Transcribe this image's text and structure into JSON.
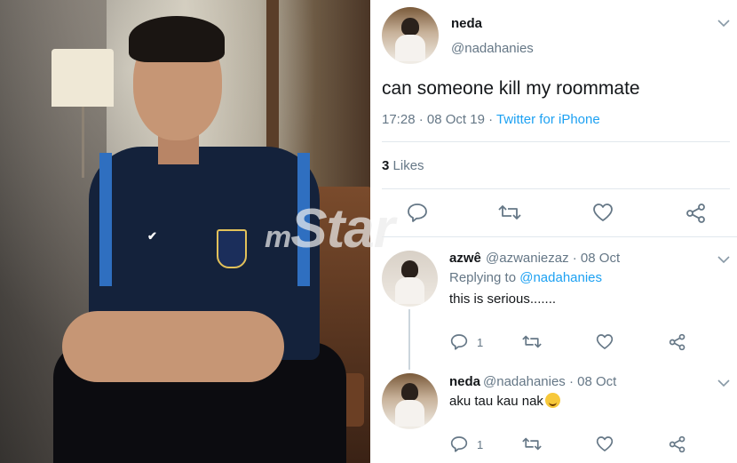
{
  "watermark": {
    "prefix": "m",
    "main": "Star"
  },
  "tweet": {
    "name": "neda",
    "handle": "@nadahanies",
    "text": "can someone kill my roommate",
    "time": "17:28 · 08 Oct 19 · ",
    "source": "Twitter for iPhone",
    "likes_count": "3",
    "likes_label": "Likes"
  },
  "replies": [
    {
      "name": "azwê",
      "handle_date": "@azwaniezaz · 08 Oct",
      "replying_prefix": "Replying to ",
      "replying_to": "@nadahanies",
      "text": "this is serious.......",
      "reply_count": "1"
    },
    {
      "name": "neda",
      "handle_date": "@nadahanies · 08 Oct",
      "text": "aku tau kau nak",
      "reply_count": "1"
    }
  ],
  "icons": [
    "chevron-down-icon",
    "reply-icon",
    "retweet-icon",
    "like-icon",
    "share-icon",
    "grinning-emoji-icon"
  ],
  "colors": {
    "link": "#1da1f2",
    "secondary": "#657786",
    "text": "#14171a",
    "border": "#e1e8ed"
  }
}
